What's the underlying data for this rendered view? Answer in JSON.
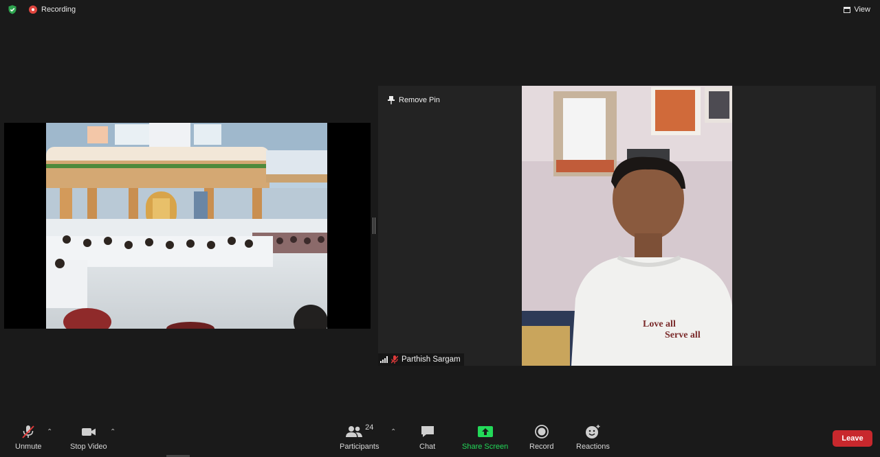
{
  "top_bar": {
    "recording_label": "Recording",
    "view_label": "View"
  },
  "participant": {
    "pin_label": "Remove Pin",
    "name": "Parthish Sargam",
    "shirt_text_line1": "Love all",
    "shirt_text_line2": "Serve all"
  },
  "toolbar": {
    "unmute_label": "Unmute",
    "stop_video_label": "Stop Video",
    "participants_label": "Participants",
    "participants_count": "24",
    "chat_label": "Chat",
    "share_screen_label": "Share Screen",
    "record_label": "Record",
    "reactions_label": "Reactions",
    "leave_label": "Leave"
  },
  "colors": {
    "background": "#1a1a1a",
    "share_green": "#23d959",
    "leave_red": "#c8282d",
    "recording_red": "#e0463f",
    "shield_green": "#2ea44f"
  }
}
